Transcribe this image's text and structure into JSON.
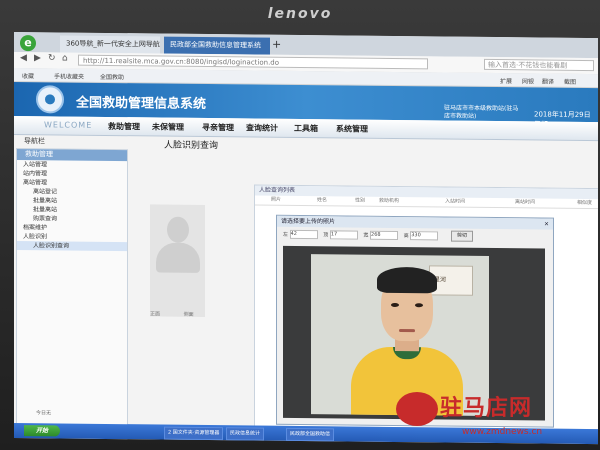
{
  "monitor": {
    "brand": "lenovo"
  },
  "browser": {
    "tabs": [
      {
        "label": "360导航_新一代安全上网导航"
      },
      {
        "label": "民政部全国救助信息管理系统"
      }
    ],
    "new_tab": "+",
    "url": "http://11.realsite.mca.gov.cn:8080/ingisd/loginaction.do",
    "search_placeholder": "输入首选·不花钱也能看剧",
    "bookmarks": [
      "收藏",
      "手机收藏夹",
      "全国救助"
    ],
    "tools": [
      "扩展",
      "网银",
      "翻译",
      "截图"
    ]
  },
  "app": {
    "title": "全国救助管理信息系统",
    "department": "驻马店市市本级救助站(驻马店市救助站)",
    "date": "2018年11月29日 星期",
    "welcome": "WELCOME",
    "menu": [
      "救助管理",
      "未保管理",
      "寻亲管理",
      "查询统计",
      "工具箱",
      "系统管理"
    ],
    "nav_title": "导航栏",
    "page_subtitle": "人脸识别查询",
    "left_panel": {
      "header": "救助管理",
      "items": [
        {
          "label": "入站管理",
          "level": 1
        },
        {
          "label": "站内管理",
          "level": 1
        },
        {
          "label": "离站管理",
          "level": 1
        },
        {
          "label": "离站登记",
          "level": 2
        },
        {
          "label": "批量离站",
          "level": 2
        },
        {
          "label": "批量离站",
          "level": 2
        },
        {
          "label": "购票查询",
          "level": 2
        },
        {
          "label": "档案维护",
          "level": 1
        },
        {
          "label": "人脸识别",
          "level": 1
        },
        {
          "label": "人脸识别查询",
          "level": 2,
          "selected": true
        }
      ],
      "footer": "今日无"
    },
    "photo_labels": [
      "正面",
      "侧面"
    ],
    "list_panel": {
      "title": "人脸查询列表",
      "columns": [
        "照片",
        "姓名",
        "性别",
        "救助机构",
        "入站时间",
        "离站时间",
        "相似度"
      ]
    },
    "dialog": {
      "title": "请选择要上传的照片",
      "close": "×",
      "fields": [
        {
          "label": "左",
          "value": "42"
        },
        {
          "label": "顶",
          "value": "17"
        },
        {
          "label": "宽",
          "value": "268"
        },
        {
          "label": "高",
          "value": "330"
        }
      ],
      "button": "剪切",
      "poster_text": "星河"
    },
    "taskbar": {
      "start": "开始",
      "tasks": [
        "2 国文件夹·资源管理器",
        "民政信息统计",
        "民政部全国救助信"
      ]
    }
  },
  "watermark": {
    "text": "驻马店网",
    "url": "www.zmdnews.cn"
  }
}
